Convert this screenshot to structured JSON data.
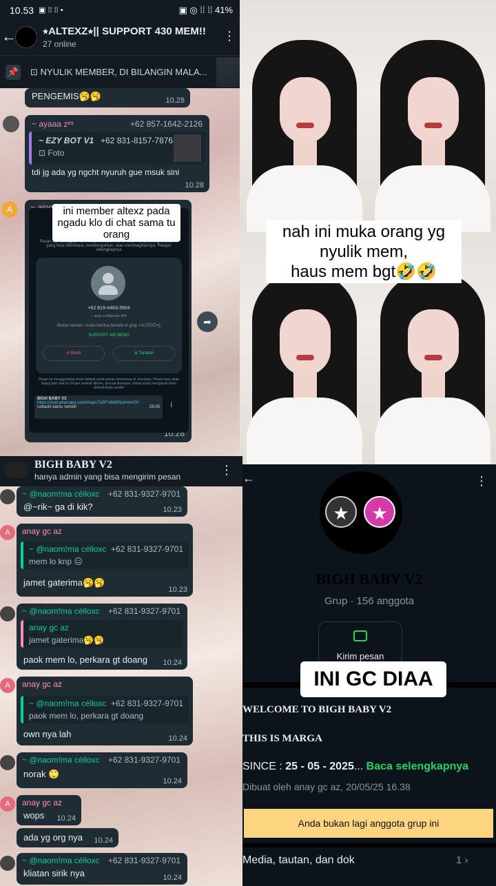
{
  "status": {
    "time": "10.53",
    "icons": "▣ ⁞⁞ ⁞⁞ •",
    "right": "▣ ◎ ⁞⁞ ⁞⁞ 41%"
  },
  "chat1": {
    "title": "⭑ALTEXZ⭑|| SUPPORT 430 MEM!!",
    "subtitle": "27 online",
    "pinned": "⊡ NYULIK MEMBER, DI BILANGIN MALA...",
    "msg1": {
      "text": "PENGEMIS🥱🥱",
      "time": "10.28"
    },
    "msg2": {
      "sender": "~ ayaaa zᵉˢ",
      "phone": "+62 857-1642-2126",
      "quote_name": "~ EZY BOT V1",
      "quote_phone": "+62 831-8157-7876",
      "quote_type": "⊡ Foto",
      "text": "tdi jg ada yg ngcht nyuruh gue msuk sini",
      "time": "10.28"
    },
    "msg3": {
      "avatar": "A",
      "sender": "~ aing",
      "caption": "ini member altexz pada ngadu klo di chat sama tu orang",
      "time": "10.28",
      "shot": {
        "info": "Pesan dan panggilan terenkripsi secara end-to-end. Hanya orang di chat ini yang bisa membaca, mendengarkan, atau membagikannya. Pelajari selengkapnya",
        "phone": "+62 819-4463-3904",
        "phone_sub": "~ anay cc/bitpunku 904",
        "contact": "Bukan kontak • Anda berdua berada di grup ⭑ALTEXZ⭑||",
        "group": "SUPPORT 430 MEM!!",
        "block": "⊘ Blokir",
        "add": "⊕ Tambah",
        "note": "Pesan ini menggunakan timer default untuk pesan sementara di chat baru. Pesan baru akan hilang dari chat ini 24 jam setelah dikirim, kecuali disimpan. Ketuk untuk mengubah timer default Anda sendiri",
        "link_title": "BIGH BABY V2",
        "link_url": "https://chat.whatsapp.com/HvjaU7zBFU66WSotrHeVDI",
        "link_text": "cobasih bantu ramein",
        "link_time": "28.05"
      }
    }
  },
  "photos": {
    "caption_l1": "nah ini muka orang yg",
    "caption_l2": "nyulik mem,",
    "caption_l3": "haus mem bgt🤣🤣"
  },
  "chat2": {
    "title": "BIGH BABY V2",
    "subtitle": "hanya admin yang bisa mengirim pesan",
    "messages": [
      {
        "sender": "~ @naom!ma célloxc",
        "phone": "+62 831-9327-9701",
        "text": "@~rik~ ga di kik?",
        "time": "10.23"
      },
      {
        "sender": "anay gc az",
        "quote_name": "~ @naom!ma célloxc",
        "quote_phone": "+62 831-9327-9701",
        "quote_text": "mem lo knp 😑",
        "text": "jamet gaterima🥱🥱",
        "time": "10.23"
      },
      {
        "sender": "~ @naom!ma célloxc",
        "phone": "+62 831-9327-9701",
        "quote_name": "anay gc az",
        "quote_text": "jamet gaterima🥱🥱",
        "text": "paok mem lo, perkara gt doang",
        "time": "10.24"
      },
      {
        "sender": "anay gc az",
        "quote_name": "~ @naom!ma célloxc",
        "quote_phone": "+62 831-9327-9701",
        "quote_text": "paok mem lo, perkara gt doang",
        "text": "own nya lah",
        "time": "10.24"
      },
      {
        "sender": "~ @naom!ma célloxc",
        "phone": "+62 831-9327-9701",
        "text": "norak 🙄",
        "time": "10.24"
      },
      {
        "sender": "anay gc az",
        "text": "wops",
        "time": "10.24"
      },
      {
        "text": "ada yg org nya",
        "time": "10.24"
      },
      {
        "sender": "~ @naom!ma célloxc",
        "phone": "+62 831-9327-9701",
        "text": "kliatan sirik nya",
        "time": "10.24"
      }
    ]
  },
  "group": {
    "name": "BIGH BABY V2",
    "sub": "Grup · 156 anggota",
    "send_label": "Kirim pesan",
    "caption": "INI GC DIAA",
    "desc_l1": "WELCOME TO BIGH BABY V2",
    "desc_l2": "THIS IS MARGA",
    "since_prefix": "SINCE : ",
    "since_date": "25 - 05 - 2025",
    "since_more": "Baca selengkapnya",
    "byline": "Dibuat oleh anay gc az, 20/05/25 16.38",
    "banner": "Anda bukan lagi anggota grup ini",
    "media": "Media, tautan, dan dok",
    "media_count": "1 ›"
  },
  "colors": {
    "accent": "#25d366",
    "bubble": "#1f2c33",
    "banner": "#fdd581"
  }
}
